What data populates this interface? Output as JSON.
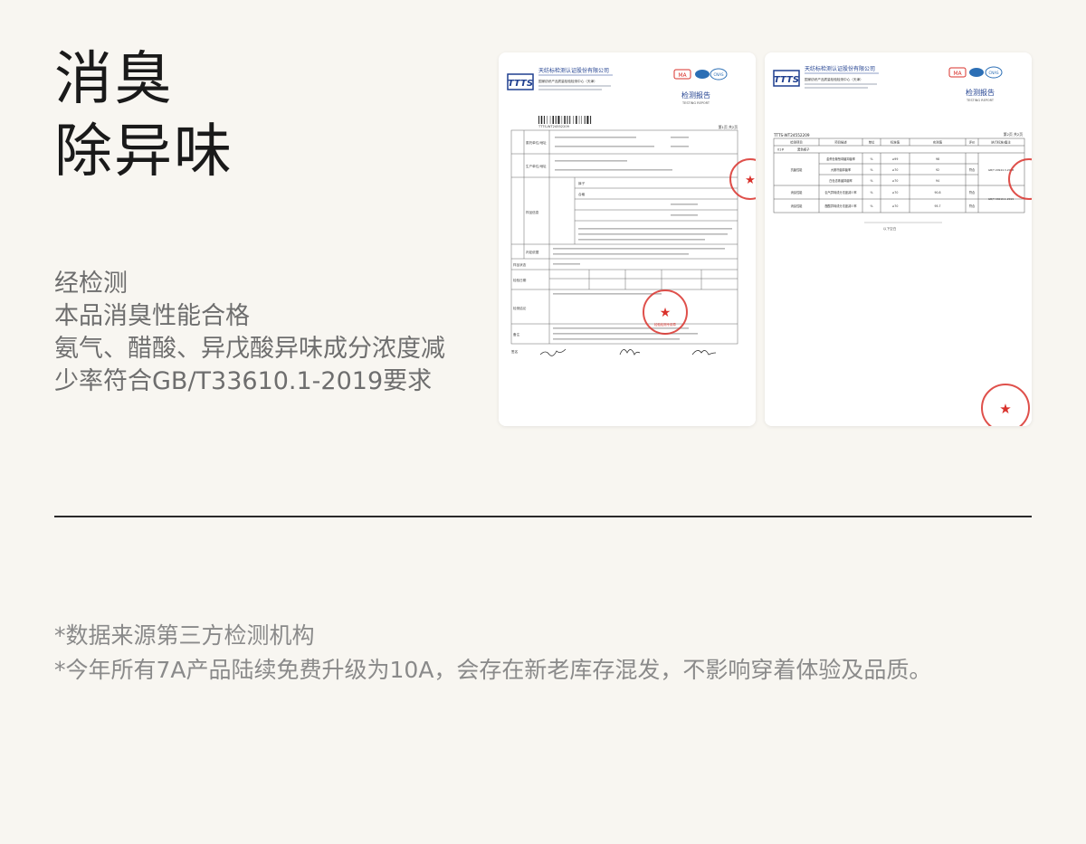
{
  "heading": {
    "line1": "消臭",
    "line2": "除异味"
  },
  "description": {
    "line1": "经检测",
    "line2": "本品消臭性能合格",
    "line3": "氨气、醋酸、异戊酸异味成分浓度减",
    "line4": "少率符合GB/T33610.1-2019要求"
  },
  "report1": {
    "logo": "TTTS",
    "company": "天纺标检测认证股份有限公司",
    "center": "国家纺织产品质量检验检测中心（天津）",
    "report_title": "检测报告",
    "report_title_en": "TESTING REPORT",
    "barcode_number": "TTTS-WT24552209",
    "page": "第1页 共2页",
    "row_labels": [
      "委托单位/地址",
      "生产单位/地址",
      "样品信息",
      "判定依据",
      "样品状态",
      "检验日期",
      "检测结论",
      "备注"
    ],
    "sample_name": "裤子",
    "sample_grade": "合格",
    "stamp_text": "天纺标检测认证股份有限公司",
    "stamp_sub": "检验检测专用章",
    "signature_label": "签名",
    "signatures": [
      "批准",
      "审核",
      "主检"
    ]
  },
  "report2": {
    "logo": "TTTS",
    "company": "天纺标检测认证股份有限公司",
    "center": "国家纺织产品质量检验检测中心（天津）",
    "report_title": "检测报告",
    "report_title_en": "TESTING REPORT",
    "report_number": "TTTS-WT24552209",
    "page": "第2页 共2页",
    "table_headers": [
      "检测项目",
      "项目描述",
      "单位",
      "标准值",
      "实测值",
      "评价",
      "执行标准/备注"
    ],
    "sample_label": "01#",
    "sample_color": "黑色裤子",
    "rows": [
      {
        "item": "抗菌性能",
        "desc": "金黄色葡萄球菌抑菌率",
        "unit": "%",
        "std": "≥99",
        "val": "98",
        "eval": "符合"
      },
      {
        "item": "",
        "desc": "大肠杆菌抑菌率",
        "unit": "%",
        "std": "≥70",
        "val": "92",
        "eval": ""
      },
      {
        "item": "",
        "desc": "白色念珠菌抑菌率",
        "unit": "%",
        "std": "≥70",
        "val": "94",
        "eval": ""
      },
      {
        "item": "消臭性能",
        "desc": "氨气异味成分浓度减少率",
        "unit": "%",
        "std": "≥70",
        "val": "90.8",
        "eval": "符合"
      },
      {
        "item": "消臭性能",
        "desc": "醋酸异味成分浓度减少率",
        "unit": "%",
        "std": "≥70",
        "val": "95.7",
        "eval": "符合"
      }
    ],
    "standard_1": "GB/T 20944.3-2008",
    "standard_2": "GB/T 33610.1-2019",
    "end_note": "以下空白",
    "stamp_text": "天纺标检测认证股份有限公司",
    "stamp_sub": "检验检测专用章"
  },
  "notes": {
    "line1": "*数据来源第三方检测机构",
    "line2": "*今年所有7A产品陆续免费升级为10A，会存在新老库存混发，不影响穿着体验及品质。"
  },
  "colors": {
    "background": "#f8f6f1",
    "stamp_red": "#d9312b",
    "logo_blue": "#1f3f8f"
  }
}
